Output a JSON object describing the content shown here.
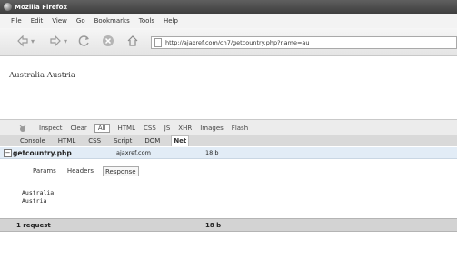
{
  "window": {
    "title": "Mozilla Firefox"
  },
  "menu": {
    "items": [
      "File",
      "Edit",
      "View",
      "Go",
      "Bookmarks",
      "Tools",
      "Help"
    ]
  },
  "navigation": {
    "url": "http://ajaxref.com/ch7/getcountry.php?name=au"
  },
  "page": {
    "text": "Australia Austria"
  },
  "firebug": {
    "toolbar": {
      "inspect": "Inspect",
      "clear": "Clear",
      "filters": [
        "All",
        "HTML",
        "CSS",
        "JS",
        "XHR",
        "Images",
        "Flash"
      ]
    },
    "tabs": [
      "Console",
      "HTML",
      "CSS",
      "Script",
      "DOM",
      "Net"
    ],
    "request": {
      "name": "getcountry.php",
      "domain": "ajaxref.com",
      "size": "18 b"
    },
    "detail": {
      "tabs": [
        "Params",
        "Headers",
        "Response"
      ],
      "response_lines": [
        "Australia",
        "Austria"
      ]
    },
    "summary": {
      "requests": "1 request",
      "total": "18 b"
    }
  },
  "colors": {
    "active_row": "#e2ecf6",
    "titlebar": "#4b4b4b"
  }
}
